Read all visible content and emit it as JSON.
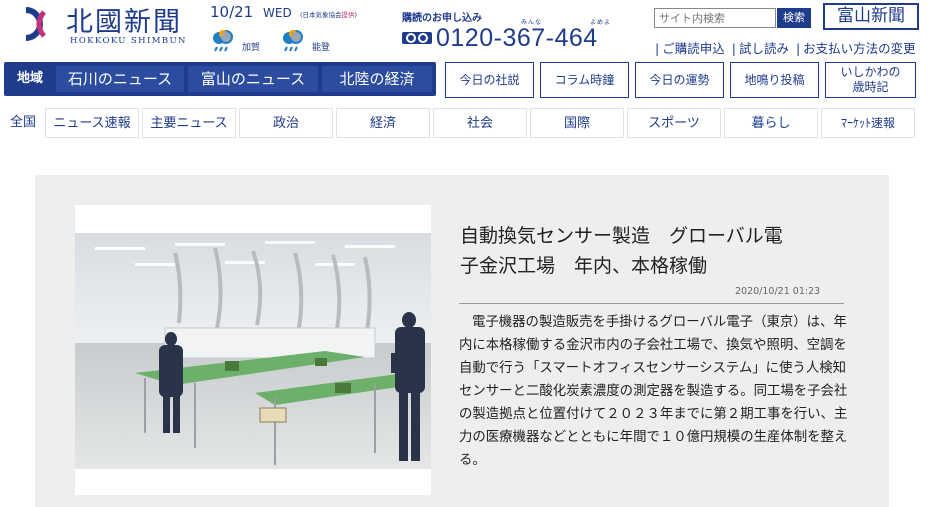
{
  "header": {
    "logo_jp": "北國新聞",
    "logo_en": "HOKKOKU SHIMBUN",
    "date": "10/21",
    "weekday": "WED",
    "jma_note_prefix": "(日本気象協会",
    "jma_note_link": "提供",
    "jma_note_suffix": ")",
    "weather": [
      {
        "region": "加賀",
        "icon": "rain-cloud-icon"
      },
      {
        "region": "能登",
        "icon": "rain-cloud-icon"
      }
    ],
    "subscribe_title": "購読のお申し込み",
    "ruby_minna": "みんな",
    "ruby_yomeyo": "よめよ",
    "phone": "0120-367-464",
    "search_placeholder": "サイト内検索",
    "search_button": "検索",
    "toyama_button": "富山新聞",
    "util_links": [
      "ご購読申込",
      "試し読み",
      "お支払い方法の変更"
    ]
  },
  "nav_primary": {
    "region_label": "地域",
    "tabs": [
      "石川のニュース",
      "富山のニュース",
      "北陸の経済"
    ],
    "boxes": [
      "今日の社説",
      "コラム時鐘",
      "今日の運勢",
      "地鳴り投稿",
      "いしかわの",
      "歳時記"
    ]
  },
  "nav_categories": [
    "全国",
    "ニュース速報",
    "主要ニュース",
    "政治",
    "経済",
    "社会",
    "国際",
    "スポーツ",
    "暮らし",
    "ﾏｰｹｯﾄ速報"
  ],
  "article": {
    "headline_line1": "自動換気センサー製造　グローバル電",
    "headline_line2": "子金沢工場　年内、本格稼働",
    "timestamp": "2020/10/21 01:23",
    "body": "電子機器の製造販売を手掛けるグローバル電子（東京）は、年内に本格稼働する金沢市内の子会社工場で、換気や照明、空調を自動で行う「スマートオフィスセンサーシステム」に使う人検知センサーと二酸化炭素濃度の測定器を製造する。同工場を子会社の製造拠点と位置付けて２０２３年までに第２期工事を行い、主力の医療機器などとともに年間で１０億円規模の生産体制を整える。",
    "photo_icon": "factory-photo"
  },
  "colors": {
    "brand_navy": "#1f3b8c",
    "brand_magenta": "#c0327a",
    "main_bg": "#eeeeee"
  }
}
